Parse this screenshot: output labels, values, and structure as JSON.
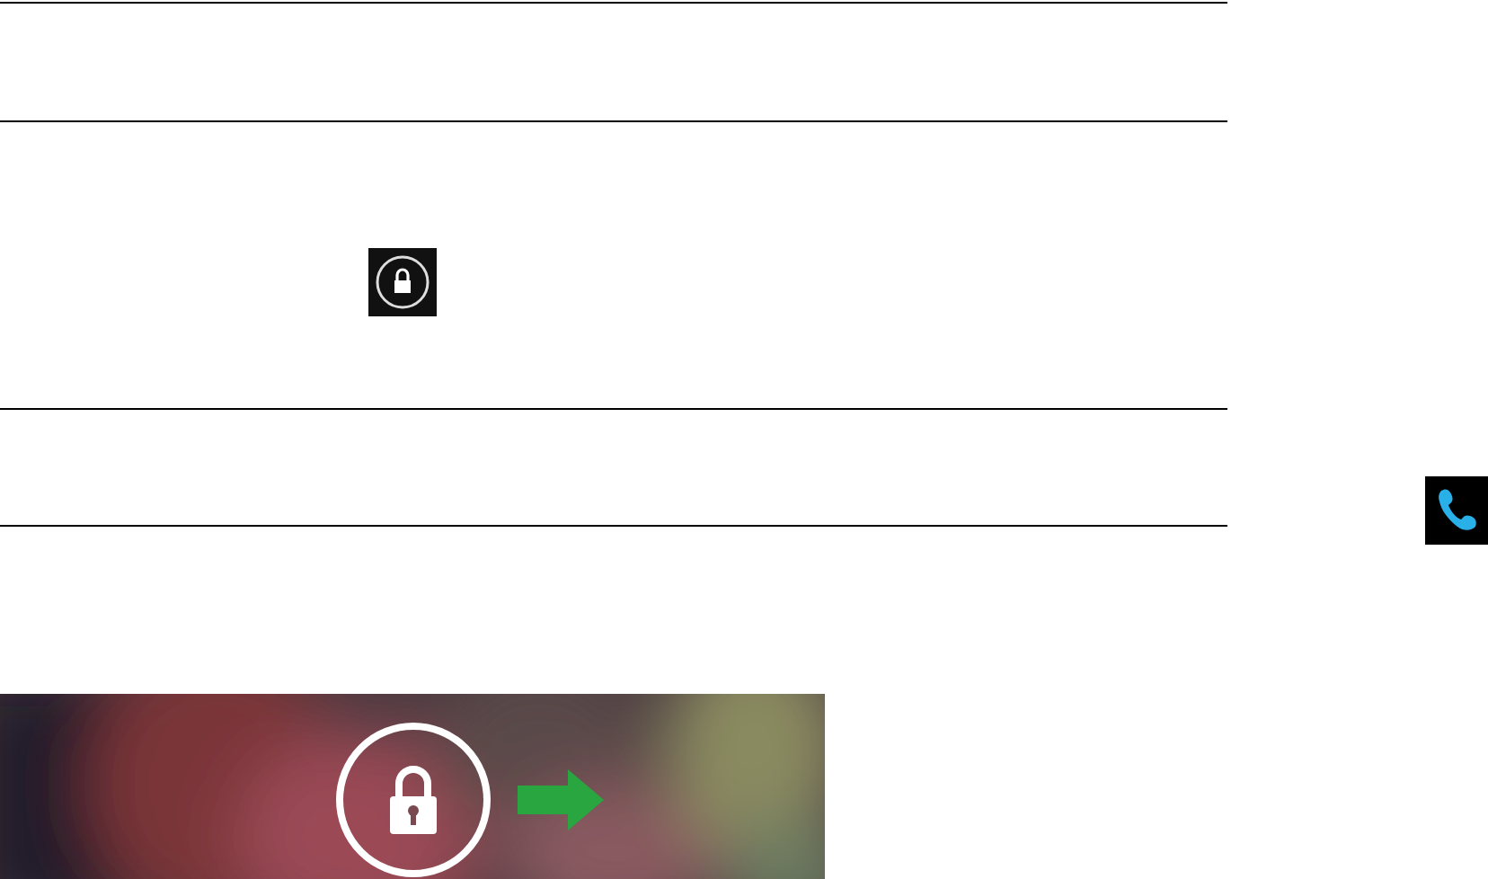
{
  "table": {
    "rows": [
      {
        "kind": "empty"
      },
      {
        "kind": "lock_icon"
      },
      {
        "kind": "empty"
      }
    ]
  },
  "side_icon": {
    "kind": "phone"
  },
  "lock_screen": {
    "kind": "unlock_hint"
  }
}
